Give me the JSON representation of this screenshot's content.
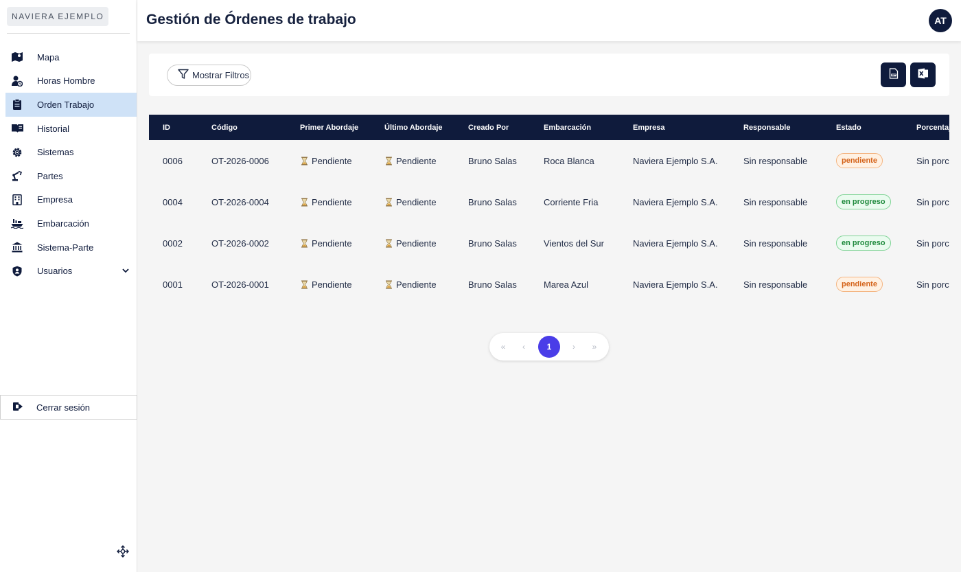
{
  "sidebar": {
    "brand": "NAVIERA EJEMPLO",
    "items": [
      {
        "label": "Mapa",
        "icon": "map-icon"
      },
      {
        "label": "Horas Hombre",
        "icon": "user-clock-icon"
      },
      {
        "label": "Orden Trabajo",
        "icon": "clipboard-icon"
      },
      {
        "label": "Historial",
        "icon": "book-icon"
      },
      {
        "label": "Sistemas",
        "icon": "gear-icon"
      },
      {
        "label": "Partes",
        "icon": "robot-arm-icon"
      },
      {
        "label": "Empresa",
        "icon": "building-icon"
      },
      {
        "label": "Embarcación",
        "icon": "ship-icon"
      },
      {
        "label": "Sistema-Parte",
        "icon": "institution-icon"
      },
      {
        "label": "Usuarios",
        "icon": "user-shield-icon"
      }
    ],
    "logout_label": "Cerrar sesión"
  },
  "header": {
    "title": "Gestión de Órdenes de trabajo",
    "avatar": "AT"
  },
  "toolbar": {
    "filter_label": "Mostrar Filtros"
  },
  "table": {
    "columns": [
      "ID",
      "Código",
      "Primer Abordaje",
      "Último Abordaje",
      "Creado Por",
      "Embarcación",
      "Empresa",
      "Responsable",
      "Estado",
      "Porcentaje"
    ],
    "rows": [
      {
        "id": "0006",
        "codigo": "OT-2026-0006",
        "primer": "Pendiente",
        "ultimo": "Pendiente",
        "creado": "Bruno Salas",
        "embarcacion": "Roca Blanca",
        "empresa": "Naviera Ejemplo S.A.",
        "responsable": "Sin responsable",
        "estado": "pendiente",
        "porcentaje": "Sin porcentaje"
      },
      {
        "id": "0004",
        "codigo": "OT-2026-0004",
        "primer": "Pendiente",
        "ultimo": "Pendiente",
        "creado": "Bruno Salas",
        "embarcacion": "Corriente Fria",
        "empresa": "Naviera Ejemplo S.A.",
        "responsable": "Sin responsable",
        "estado": "en progreso",
        "porcentaje": "Sin porcentaje"
      },
      {
        "id": "0002",
        "codigo": "OT-2026-0002",
        "primer": "Pendiente",
        "ultimo": "Pendiente",
        "creado": "Bruno Salas",
        "embarcacion": "Vientos del Sur",
        "empresa": "Naviera Ejemplo S.A.",
        "responsable": "Sin responsable",
        "estado": "en progreso",
        "porcentaje": "Sin porcentaje"
      },
      {
        "id": "0001",
        "codigo": "OT-2026-0001",
        "primer": "Pendiente",
        "ultimo": "Pendiente",
        "creado": "Bruno Salas",
        "embarcacion": "Marea Azul",
        "empresa": "Naviera Ejemplo S.A.",
        "responsable": "Sin responsable",
        "estado": "pendiente",
        "porcentaje": "Sin porcentaje"
      }
    ]
  },
  "pagination": {
    "first": "«",
    "prev": "‹",
    "current": "1",
    "next": "›",
    "last": "»"
  },
  "colors": {
    "navy": "#0f1b3c",
    "active_nav": "#cfe2f7",
    "page_current": "#4a3de8",
    "pending": "#d4631a",
    "in_progress": "#1f8a3d"
  }
}
